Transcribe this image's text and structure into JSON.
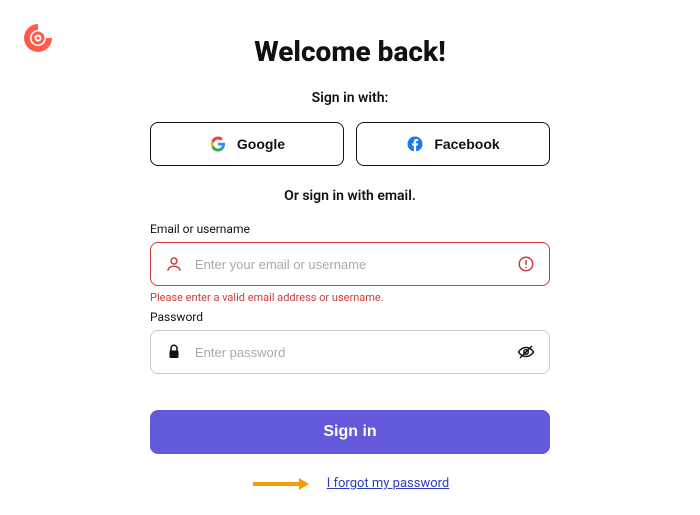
{
  "header": {
    "title": "Welcome back!",
    "subtitle": "Sign in with:"
  },
  "social": {
    "google_label": "Google",
    "facebook_label": "Facebook"
  },
  "divider": {
    "text": "Or sign in with email."
  },
  "email": {
    "label": "Email or username",
    "placeholder": "Enter your email or username",
    "error": "Please enter a valid email address or username."
  },
  "password": {
    "label": "Password",
    "placeholder": "Enter password"
  },
  "actions": {
    "signin_label": "Sign in",
    "forgot_label": "I forgot my password"
  },
  "colors": {
    "primary": "#6259db",
    "error": "#d13b3b",
    "logo": "#fd5e4a"
  }
}
